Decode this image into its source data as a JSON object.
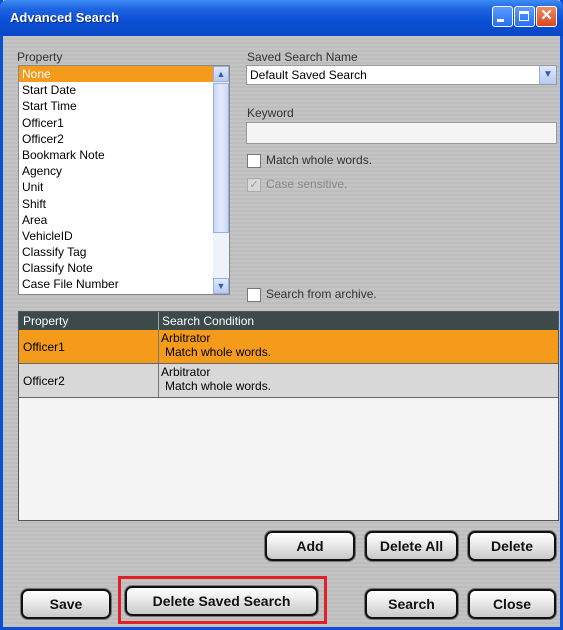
{
  "window": {
    "title": "Advanced Search"
  },
  "property": {
    "label": "Property",
    "items": [
      "None",
      "Start Date",
      "Start Time",
      "Officer1",
      "Officer2",
      "Bookmark Note",
      "Agency",
      "Unit",
      "Shift",
      "Area",
      "VehicleID",
      "Classify Tag",
      "Classify Note",
      "Case File Number"
    ],
    "selected": "None"
  },
  "saved_search": {
    "label": "Saved Search Name",
    "value": "Default Saved Search"
  },
  "keyword": {
    "label": "Keyword",
    "value": ""
  },
  "options": {
    "match_whole_words": {
      "label": "Match whole words.",
      "checked": false
    },
    "case_sensitive": {
      "label": "Case sensitive.",
      "checked": true,
      "disabled": true
    },
    "search_archive": {
      "label": "Search from archive.",
      "checked": false
    }
  },
  "grid": {
    "headers": {
      "property": "Property",
      "condition": "Search Condition"
    },
    "rows": [
      {
        "property": "Officer1",
        "condition_line1": "Arbitrator",
        "condition_line2": "Match whole words."
      },
      {
        "property": "Officer2",
        "condition_line1": "Arbitrator",
        "condition_line2": "Match whole words."
      }
    ]
  },
  "buttons": {
    "add": "Add",
    "delete_all": "Delete All",
    "delete": "Delete",
    "save": "Save",
    "delete_saved_search": "Delete Saved Search",
    "search": "Search",
    "close": "Close"
  },
  "colors": {
    "selection": "#f59b1c",
    "titlebar": "#0a4fd6",
    "highlight": "#e0202a"
  }
}
